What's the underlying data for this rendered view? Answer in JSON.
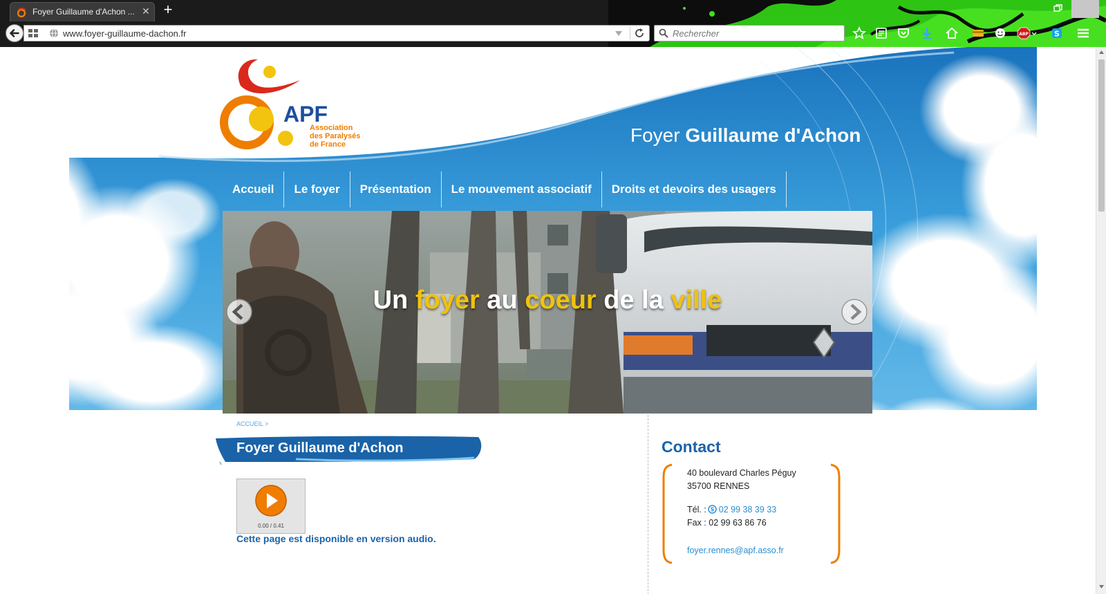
{
  "browser": {
    "tab_title": "Foyer Guillaume d'Achon ...",
    "url": "www.foyer-guillaume-dachon.fr",
    "search_placeholder": "Rechercher"
  },
  "header": {
    "site_title_light": "Foyer ",
    "site_title_bold": "Guillaume d'Achon",
    "logo_word": "APF",
    "logo_sub": [
      "Association",
      "des Paralysés",
      "de France"
    ]
  },
  "nav": [
    "Accueil",
    "Le foyer",
    "Présentation",
    "Le mouvement associatif",
    "Droits et devoirs des usagers"
  ],
  "slider": {
    "caption_parts": [
      {
        "text": "Un ",
        "highlight": false
      },
      {
        "text": "foyer",
        "highlight": true
      },
      {
        "text": " au ",
        "highlight": false
      },
      {
        "text": "coeur",
        "highlight": true
      },
      {
        "text": " de la ",
        "highlight": false
      },
      {
        "text": "ville",
        "highlight": true
      }
    ]
  },
  "content": {
    "breadcrumb": "ACCUEIL >",
    "title": "Foyer Guillaume d'Achon",
    "player_time": "0.00 / 0.41",
    "audio_note": "Cette page est disponible en version audio."
  },
  "contact": {
    "title": "Contact",
    "address1": "40 boulevard Charles Péguy",
    "address2": "35700 RENNES",
    "tel_label": "Tél. :",
    "tel": "02 99 38 39 33",
    "fax": "Fax : 02 99 63 86 76",
    "email": "foyer.rennes@apf.asso.fr"
  },
  "colors": {
    "brand_blue": "#1a63a8",
    "brand_orange": "#ef7d00",
    "sky": "#3a9fdc",
    "caption_yellow": "#f0c20c",
    "chrome_green": "#39d31b"
  }
}
